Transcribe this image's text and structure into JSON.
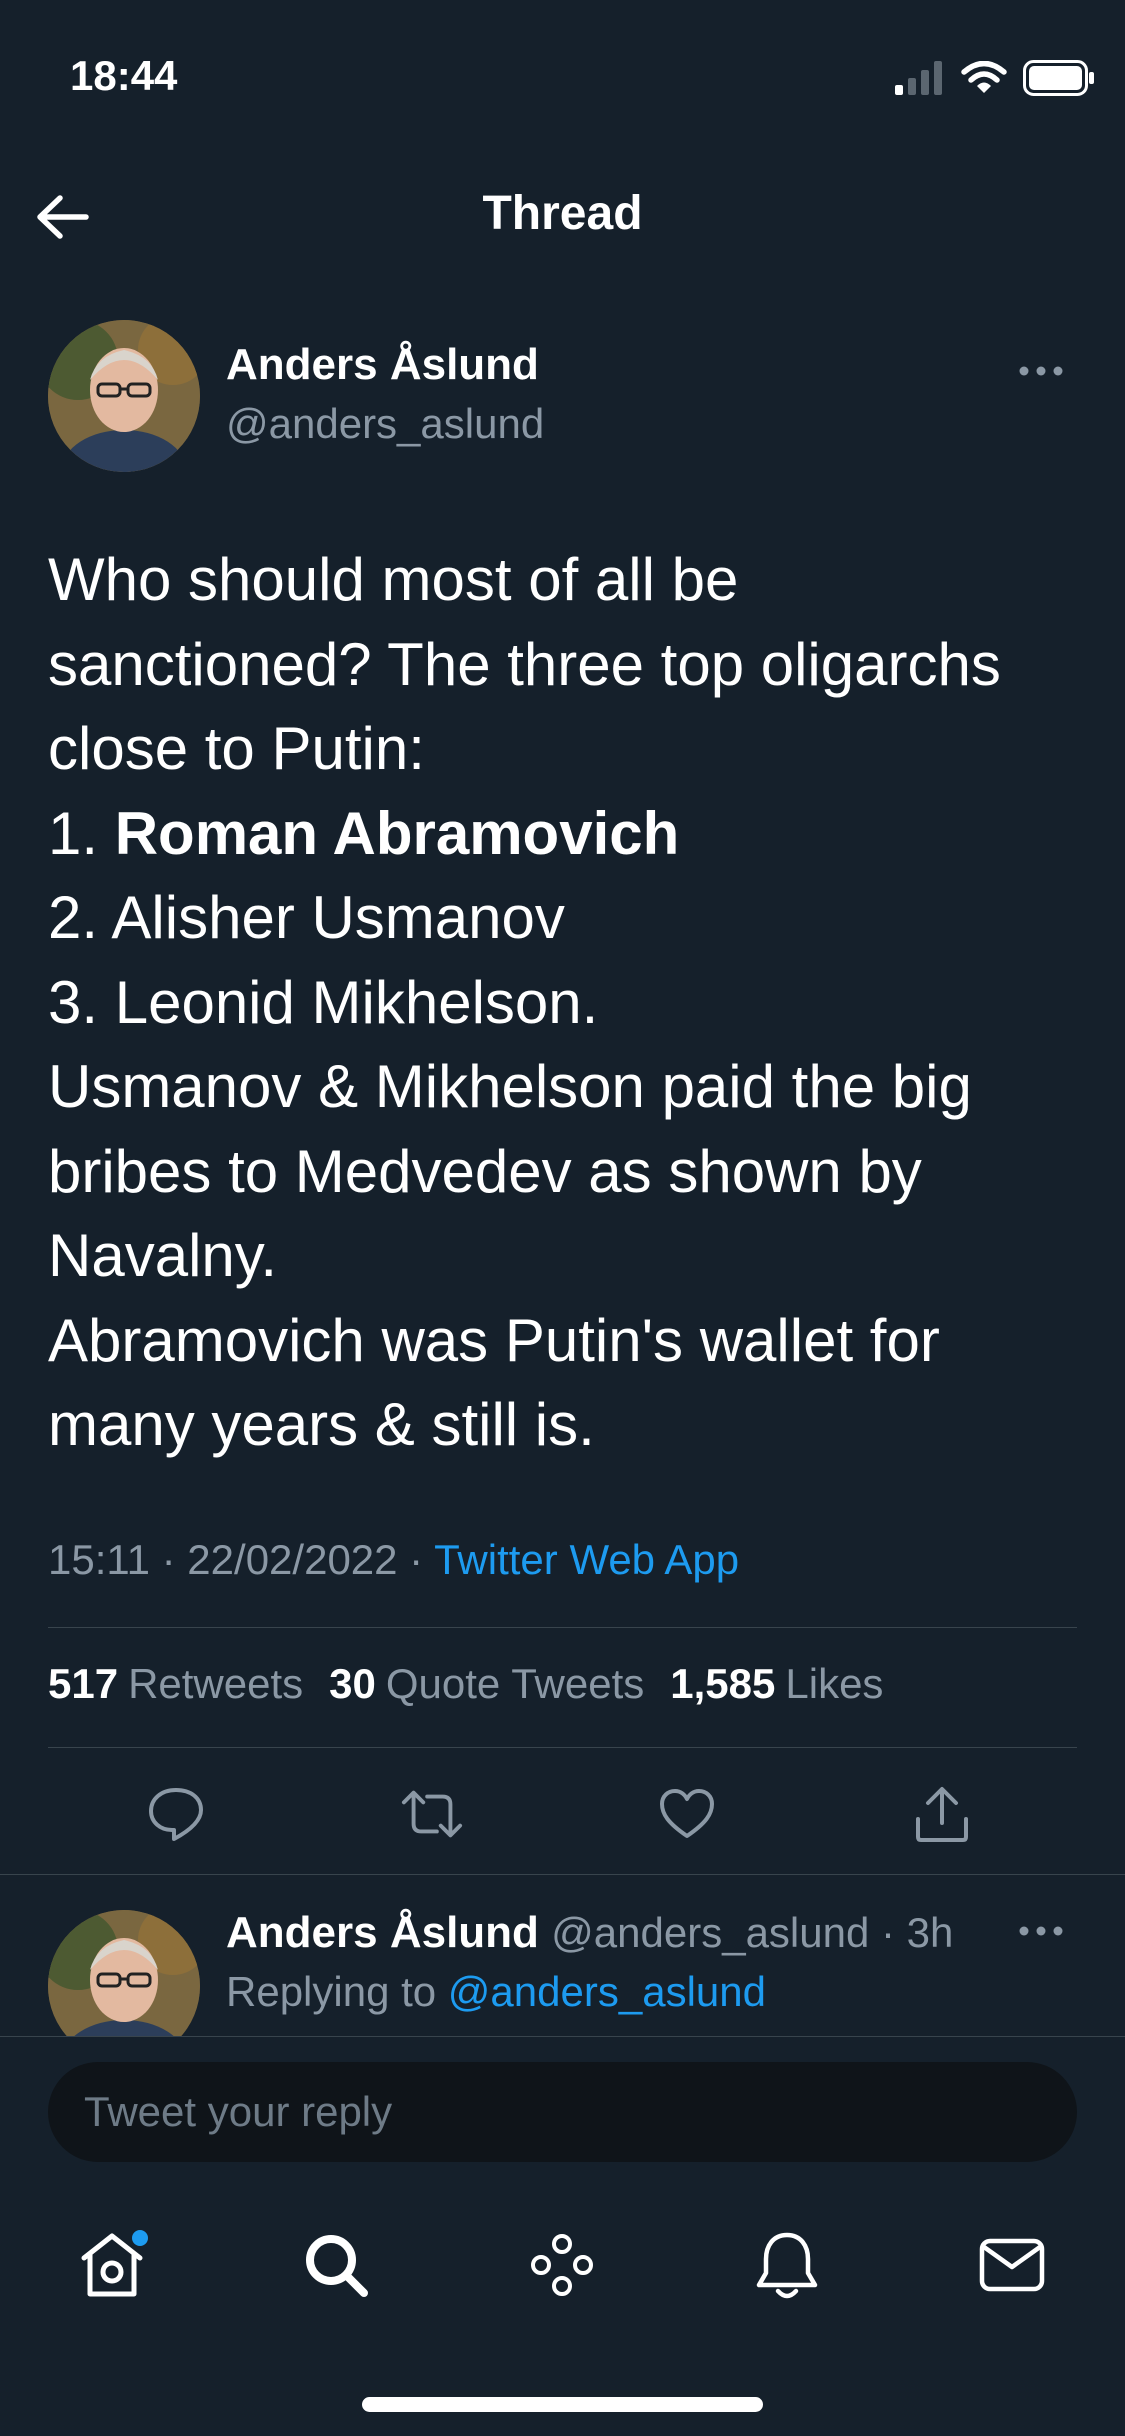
{
  "status_bar": {
    "time": "18:44"
  },
  "header": {
    "title": "Thread"
  },
  "tweet": {
    "author_name": "Anders Åslund",
    "author_handle": "@anders_aslund",
    "body_lines": [
      "Who should most of all be",
      "sanctioned? The three top oligarchs",
      "close to Putin:",
      "Roman Abramovich",
      "2. Alisher Usmanov",
      "3. Leonid Mikhelson.",
      "Usmanov & Mikhelson paid the big",
      "bribes to Medvedev as shown by",
      "Navalny.",
      "Abramovich was Putin's wallet for",
      "many years & still is."
    ],
    "list_prefix_1": "1.",
    "timestamp": "15:11 · 22/02/2022 · ",
    "source_app": "Twitter Web App",
    "retweets_count": "517",
    "retweets_label": "Retweets",
    "quotes_count": "30",
    "quotes_label": "Quote Tweets",
    "likes_count": "1,585",
    "likes_label": "Likes"
  },
  "reply": {
    "author_name": "Anders Åslund",
    "author_handle": "@anders_aslund",
    "time_ago": "3h",
    "replying_to_label": "Replying to ",
    "replying_to_handle": "@anders_aslund"
  },
  "composer": {
    "placeholder": "Tweet your reply"
  },
  "tab_bar": {
    "items": [
      "home-icon",
      "search-icon",
      "spaces-icon",
      "notifications-icon",
      "messages-icon"
    ],
    "home_has_notification": true
  },
  "colors": {
    "background": "#15202b",
    "accent": "#1d9bf0",
    "secondary_text": "#8b98a5"
  }
}
